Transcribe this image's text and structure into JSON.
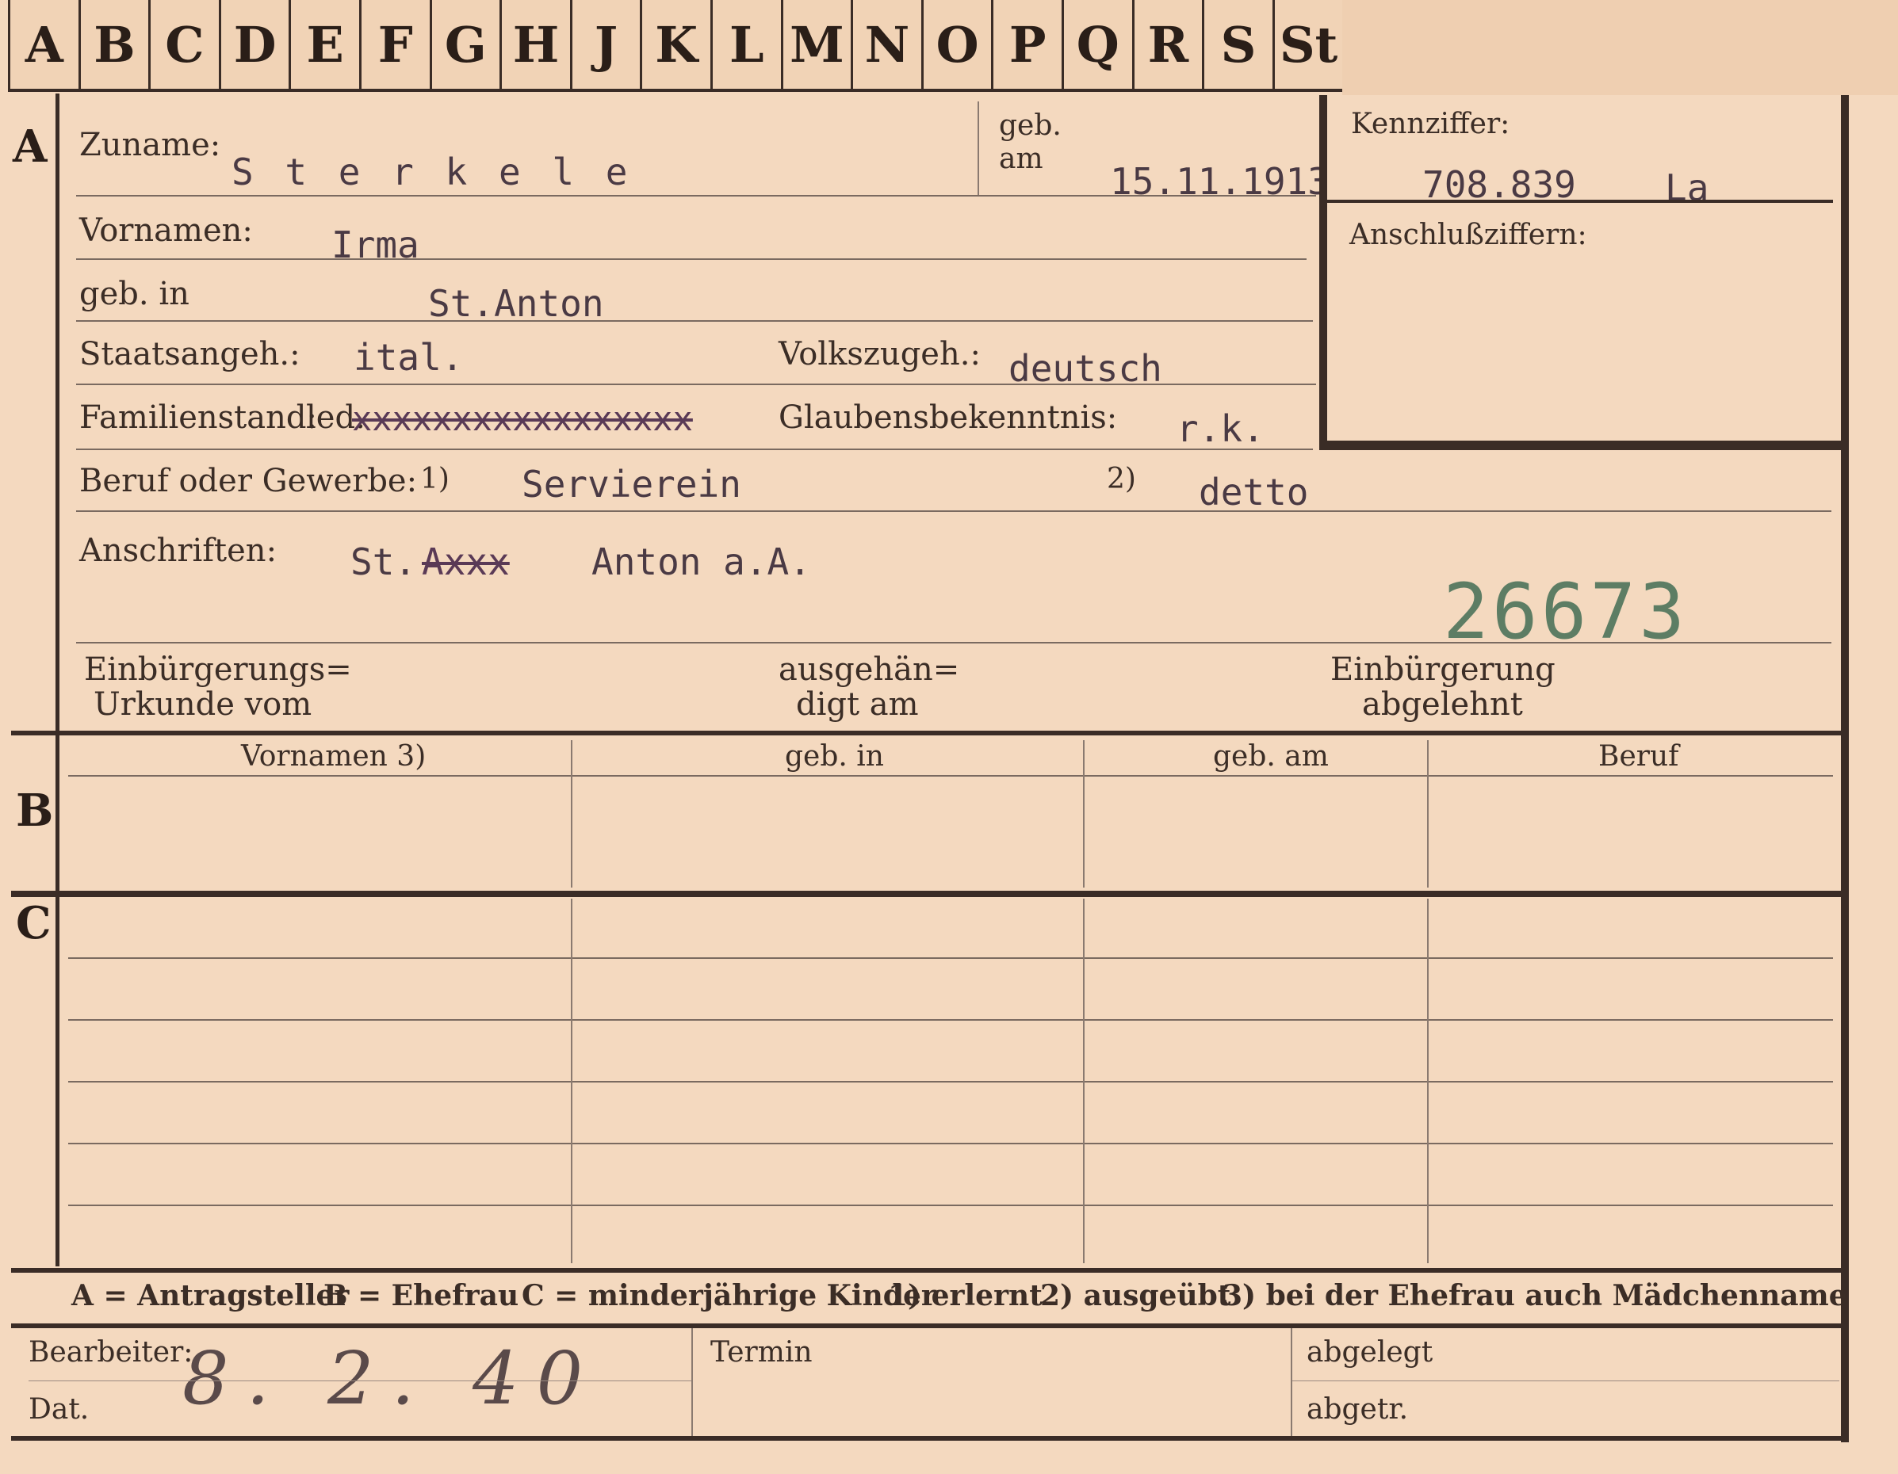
{
  "tabs": [
    "A",
    "B",
    "C",
    "D",
    "E",
    "F",
    "G",
    "H",
    "J",
    "K",
    "L",
    "M",
    "N",
    "O",
    "P",
    "Q",
    "R",
    "S",
    "St"
  ],
  "sections": {
    "a": "A",
    "b": "B",
    "c": "C"
  },
  "a": {
    "zuname_label": "Zuname:",
    "zuname_value": "S t e r k e l e",
    "geb_am_label_1": "geb.",
    "geb_am_label_2": "am",
    "geb_am_value": "15.11.1913",
    "kennziffer_label": "Kennziffer:",
    "kennziffer_value": "708.839",
    "kennziffer_suffix": "La",
    "anschluss_label": "Anschlußziffern:",
    "vornamen_label": "Vornamen:",
    "vornamen_value": "Irma",
    "geb_in_label": "geb. in",
    "geb_in_value": "St.Anton",
    "staatsangeh_label": "Staatsangeh.:",
    "staatsangeh_value": "ital.",
    "volkszugeh_label": "Volkszugeh.:",
    "volkszugeh_value": "deutsch",
    "familienstand_label": "Familienstand:",
    "familienstand_value": "led.",
    "familienstand_struck": "xxxxxxxxxxxxxxxxx",
    "glaubens_label": "Glaubensbekenntnis:",
    "glaubens_value": "r.k.",
    "beruf_label": "Beruf oder Gewerbe:",
    "beruf_note1": "1)",
    "beruf_value1": "Servierein",
    "beruf_note2": "2)",
    "beruf_value2": "detto",
    "anschriften_label": "Anschriften:",
    "anschriften_value1": "St.",
    "anschriften_struck": "Axxx",
    "anschriften_value2": "Anton a.A.",
    "stamp_number": "26673",
    "urkunde_label_1": "Einbürgerungs=",
    "urkunde_label_2": "Urkunde vom",
    "ausgehaendigt_label_1": "ausgehän=",
    "ausgehaendigt_label_2": "digt am",
    "abgelehnt_label_1": "Einbürgerung",
    "abgelehnt_label_2": "abgelehnt"
  },
  "b": {
    "columns": [
      "Vornamen 3)",
      "geb. in",
      "geb. am",
      "Beruf"
    ]
  },
  "legend": {
    "a": "A = Antragsteller",
    "b": "B = Ehefrau",
    "c": "C = minderjährige Kinder",
    "n1": "1) erlernt",
    "n2": "2) ausgeübt",
    "n3": "3) bei der Ehefrau auch Mädchenname"
  },
  "footer": {
    "bearbeiter_label": "Bearbeiter:",
    "dat_label": "Dat.",
    "dat_value": "8. 2. 40",
    "termin_label": "Termin",
    "abgelegt_label": "abgelegt",
    "abgetr_label": "abgetr."
  }
}
